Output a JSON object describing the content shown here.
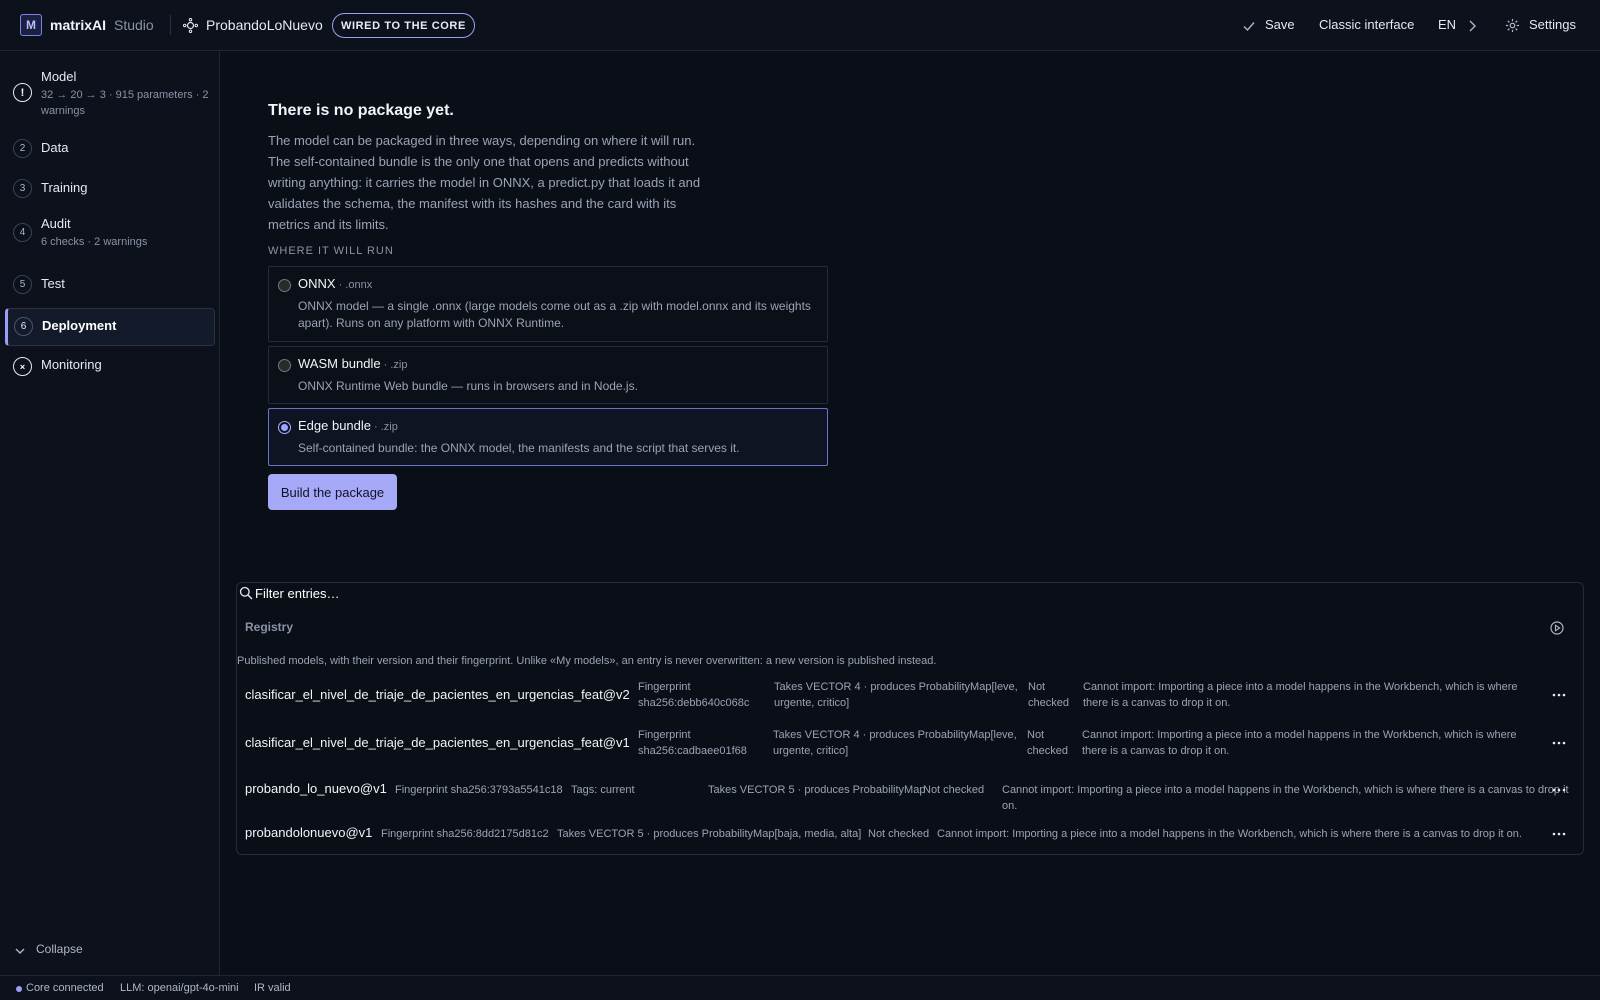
{
  "header": {
    "logo_letter": "M",
    "brand": "matrixAI",
    "brand_sub": "Studio",
    "project": "ProbandoLoNuevo",
    "pill": "WIRED TO THE CORE",
    "save": "Save",
    "classic": "Classic interface",
    "lang": "EN",
    "settings": "Settings"
  },
  "sidebar": {
    "items": [
      {
        "badge": "!",
        "label": "Model",
        "sub": "32 → 20 → 3 · 915 parameters · 2 warnings"
      },
      {
        "badge": "2",
        "label": "Data",
        "sub": ""
      },
      {
        "badge": "3",
        "label": "Training",
        "sub": ""
      },
      {
        "badge": "4",
        "label": "Audit",
        "sub": "6 checks · 2 warnings"
      },
      {
        "badge": "5",
        "label": "Test",
        "sub": ""
      },
      {
        "badge": "6",
        "label": "Deployment",
        "sub": ""
      },
      {
        "badge": "×",
        "label": "Monitoring",
        "sub": ""
      }
    ],
    "active_index": 5,
    "collapse": "Collapse"
  },
  "package": {
    "title": "There is no package yet.",
    "description": "The model can be packaged in three ways, depending on where it will run. The self-contained bundle is the only one that opens and predicts without writing anything: it carries the model in ONNX, a predict.py that loads it and validates the schema, the manifest with its hashes and the card with its metrics and its limits.",
    "where_label": "WHERE IT WILL RUN",
    "options": [
      {
        "name": "ONNX",
        "ext": "· .onnx",
        "desc": "ONNX model — a single .onnx (large models come out as a .zip with model.onnx and its weights apart). Runs on any platform with ONNX Runtime.",
        "selected": false
      },
      {
        "name": "WASM bundle",
        "ext": "· .zip",
        "desc": "ONNX Runtime Web bundle — runs in browsers and in Node.js.",
        "selected": false
      },
      {
        "name": "Edge bundle",
        "ext": "· .zip",
        "desc": "Self-contained bundle: the ONNX model, the manifests and the script that serves it.",
        "selected": true
      }
    ],
    "build_button": "Build the package"
  },
  "registry": {
    "filter_placeholder": "Filter entries…",
    "title": "Registry",
    "description": "Published models, with their version and their fingerprint. Unlike «My models», an entry is never overwritten: a new version is published instead.",
    "entries": [
      {
        "name": "clasificar_el_nivel_de_triaje_de_pacientes_en_urgencias_feat@v2",
        "fingerprint": "Fingerprint sha256:debb640c068c",
        "tags": "",
        "io": "Takes VECTOR 4 · produces ProbabilityMap[leve, urgente, critico]",
        "check": "Not checked",
        "import": "Cannot import: Importing a piece into a model happens in the Workbench, which is where there is a canvas to drop it on."
      },
      {
        "name": "clasificar_el_nivel_de_triaje_de_pacientes_en_urgencias_feat@v1",
        "fingerprint": "Fingerprint sha256:cadbaee01f68",
        "tags": "",
        "io": "Takes VECTOR 4 · produces ProbabilityMap[leve, urgente, critico]",
        "check": "Not checked",
        "import": "Cannot import: Importing a piece into a model happens in the Workbench, which is where there is a canvas to drop it on."
      },
      {
        "name": "probando_lo_nuevo@v1",
        "fingerprint": "Fingerprint sha256:3793a5541c18",
        "tags": "Tags: current",
        "io": "Takes VECTOR 5 · produces ProbabilityMap",
        "check": "Not checked",
        "import": "Cannot import: Importing a piece into a model happens in the Workbench, which is where there is a canvas to drop it on."
      },
      {
        "name": "probandolonuevo@v1",
        "fingerprint": "Fingerprint sha256:8dd2175d81c2",
        "tags": "",
        "io": "Takes VECTOR 5 · produces ProbabilityMap[baja, media, alta]",
        "check": "Not checked",
        "import": "Cannot import: Importing a piece into a model happens in the Workbench, which is where there is a canvas to drop it on."
      }
    ]
  },
  "status": {
    "core": "Core connected",
    "llm": "LLM: openai/gpt-4o-mini",
    "ir": "IR valid"
  },
  "colors": {
    "accent": "#a5a9f8",
    "background": "#0a0e17",
    "panel": "#0c111b"
  }
}
